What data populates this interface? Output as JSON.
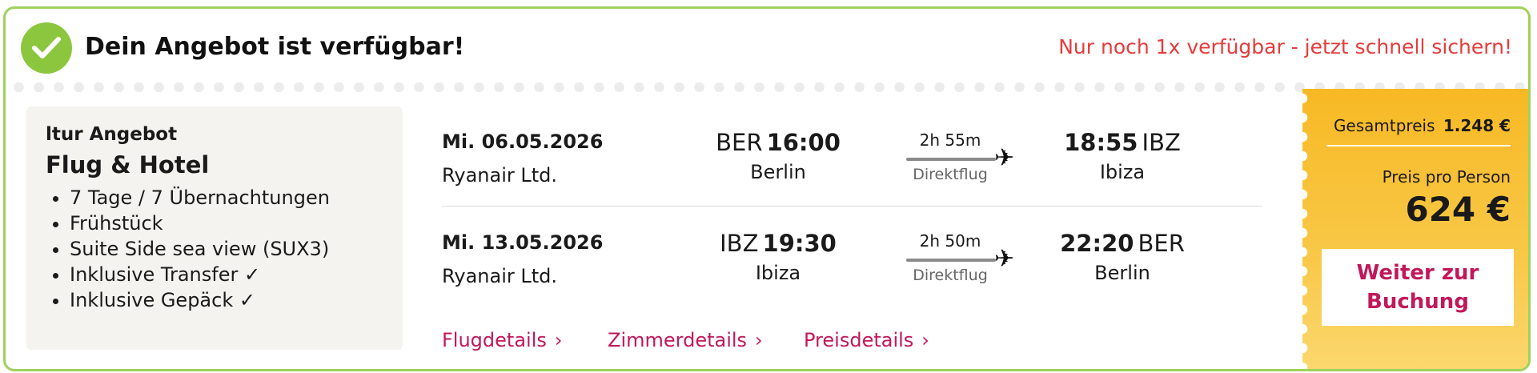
{
  "header": {
    "title": "Dein Angebot ist verfügbar!",
    "urgency": "Nur noch 1x verfügbar - jetzt schnell sichern!"
  },
  "offer": {
    "brand": "ltur Angebot",
    "type": "Flug & Hotel",
    "features": [
      "7 Tage / 7 Übernachtungen",
      "Frühstück",
      "Suite Side sea view (SUX3)",
      "Inklusive Transfer ✓",
      "Inklusive Gepäck ✓"
    ]
  },
  "flights": [
    {
      "date": "Mi. 06.05.2026",
      "airline": "Ryanair Ltd.",
      "dep_code": "BER",
      "dep_time": "16:00",
      "dep_city": "Berlin",
      "duration": "2h 55m",
      "kind": "Direktflug",
      "arr_time": "18:55",
      "arr_code": "IBZ",
      "arr_city": "Ibiza"
    },
    {
      "date": "Mi. 13.05.2026",
      "airline": "Ryanair Ltd.",
      "dep_code": "IBZ",
      "dep_time": "19:30",
      "dep_city": "Ibiza",
      "duration": "2h 50m",
      "kind": "Direktflug",
      "arr_time": "22:20",
      "arr_code": "BER",
      "arr_city": "Berlin"
    }
  ],
  "links": {
    "flight_details": "Flugdetails",
    "room_details": "Zimmerdetails",
    "price_details": "Preisdetails"
  },
  "price": {
    "total_label": "Gesamtpreis",
    "total_value": "1.248 €",
    "per_person_label": "Preis pro Person",
    "per_person_value": "624 €",
    "book_button": "Weiter zur Buchung"
  },
  "colors": {
    "accent_green": "#8cc63f",
    "urgency_red": "#e83b3b",
    "link_pink": "#c2185b",
    "price_yellow": "#f7b924"
  }
}
